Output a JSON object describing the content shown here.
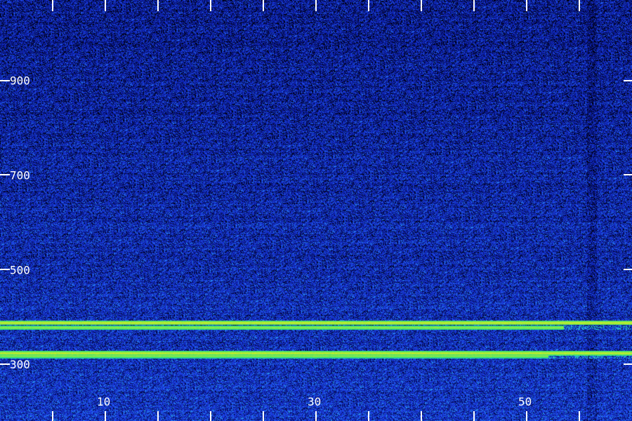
{
  "chart_data": {
    "type": "heatmap",
    "title": "",
    "xlabel": "",
    "ylabel": "",
    "xlim": [
      0,
      60
    ],
    "ylim": [
      180,
      1070
    ],
    "x_ticks": [
      0,
      5,
      10,
      15,
      20,
      25,
      30,
      35,
      40,
      45,
      50,
      55,
      60
    ],
    "x_tick_labels": [
      {
        "value": 10,
        "text": "10"
      },
      {
        "value": 30,
        "text": "30"
      },
      {
        "value": 50,
        "text": "50"
      }
    ],
    "y_ticks": [
      900,
      700,
      500,
      300
    ],
    "y_tick_labels": [
      {
        "value": 900,
        "text": "900"
      },
      {
        "value": 700,
        "text": "700"
      },
      {
        "value": 500,
        "text": "500"
      },
      {
        "value": 300,
        "text": "300"
      }
    ],
    "colormap": [
      "#000010",
      "#0a1a9c",
      "#1f46f0",
      "#2aa8f0",
      "#2ee07a",
      "#d8f020"
    ],
    "bands": [
      {
        "y": 388,
        "x_range": [
          0,
          60
        ],
        "intensity": 1.0
      },
      {
        "y": 378,
        "x_range": [
          0,
          53.5
        ],
        "intensity": 0.7
      },
      {
        "y": 324,
        "x_range": [
          0,
          60
        ],
        "intensity": 0.95
      },
      {
        "y": 318,
        "x_range": [
          0,
          52
        ],
        "intensity": 0.65
      }
    ],
    "background_noise": "blue speckle, denser and brighter toward low y"
  }
}
